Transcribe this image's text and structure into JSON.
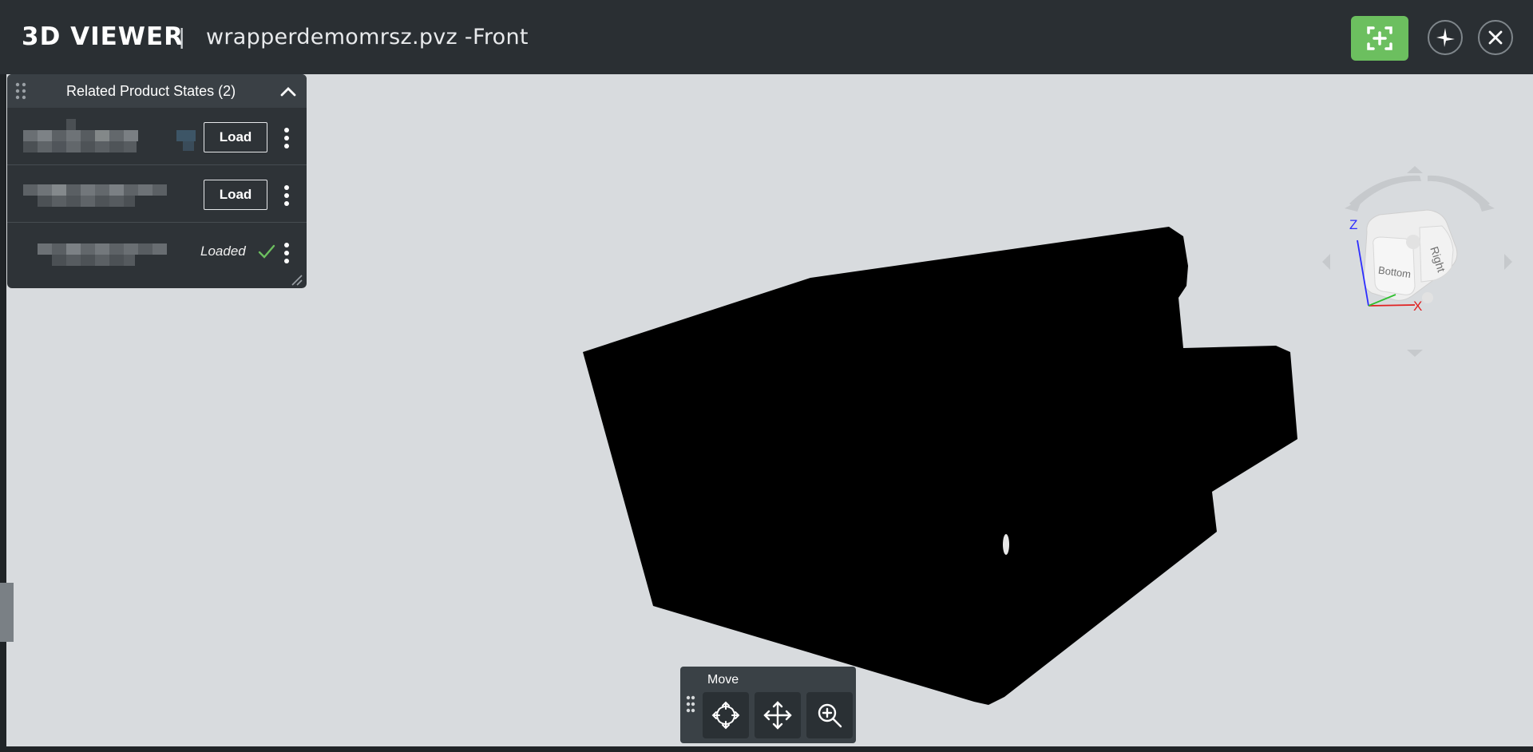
{
  "header": {
    "app_title": "3D VIEWER",
    "separator": "|",
    "file_name": "wrapperdemomrsz.pvz -Front",
    "fullscreen_icon": "fullscreen-add-icon",
    "reset_view_icon": "reset-view-icon",
    "close_icon": "close-icon",
    "accent_color": "#6cbf5f"
  },
  "related_states": {
    "title": "Related Product States (2)",
    "rows": [
      {
        "action_label": "Load"
      },
      {
        "action_label": "Load"
      },
      {
        "status_label": "Loaded",
        "status_color": "#6cbf5f"
      }
    ]
  },
  "nav_cube": {
    "face_bottom": "Bottom",
    "face_right": "Right",
    "axis_z": "Z",
    "axis_x": "X",
    "axis_z_color": "#2c2cff",
    "axis_x_color": "#e02020"
  },
  "toolbar": {
    "label": "Move",
    "tools": [
      "rotate-icon",
      "pan-icon",
      "zoom-icon"
    ]
  }
}
